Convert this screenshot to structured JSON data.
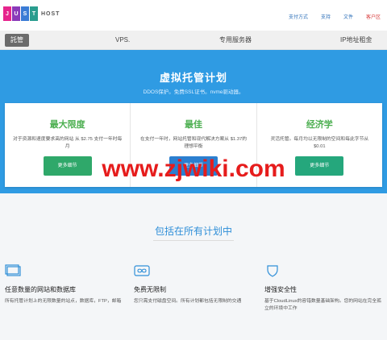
{
  "header": {
    "logo_letters": [
      "J",
      "U",
      "S",
      "T"
    ],
    "logo_colors": [
      "#e6258d",
      "#8a3ab9",
      "#3a7bd5",
      "#2a9d8f"
    ],
    "logo_suffix": "HOST",
    "links": [
      "支付方式",
      "支持",
      "文件",
      "客户区"
    ]
  },
  "nav": {
    "items": [
      "託管",
      "VPS.",
      "专用服务器",
      "IP地址租金"
    ]
  },
  "hero": {
    "title": "虚拟托管计划",
    "subtitle": "DDOS保护。免费SSL证书。nvme驱动器。"
  },
  "plans": [
    {
      "title": "最大限度",
      "desc": "对于资源和速度要求高的网站 从 $2.75 支付一年时每月",
      "button": "更多细节"
    },
    {
      "title": "最佳",
      "desc": "在支付一年时，网站托管和现代解决方案从 $1.37的理想平衡",
      "button": "更多细节"
    },
    {
      "title": "经济学",
      "desc": "灵活托管。每月均以无限制的空间和每此字节从$0.01",
      "button": "更多细节"
    }
  ],
  "watermark": "www.zjwiki.com",
  "features": {
    "heading": "包括在所有计划中",
    "items": [
      {
        "icon": "monitor-icon",
        "title": "任意数量的网站和数据库",
        "desc": "所有托管计划上的无限数量的站点，数据库，FTP，邮箱"
      },
      {
        "icon": "infinity-icon",
        "title": "免费无限制",
        "desc": "您只需支付磁盘空间。所有计划都包括无限制的交通"
      },
      {
        "icon": "shield-icon",
        "title": "增强安全性",
        "desc": "基于CloudLinux的容错数量基础架构。您的网站在完全孤立的环境中工作"
      }
    ]
  },
  "colors": {
    "hero_bg": "#2f9be3",
    "plan_title": "#4caf50",
    "watermark": "#e61c1c",
    "link": "#2a6eb8"
  }
}
